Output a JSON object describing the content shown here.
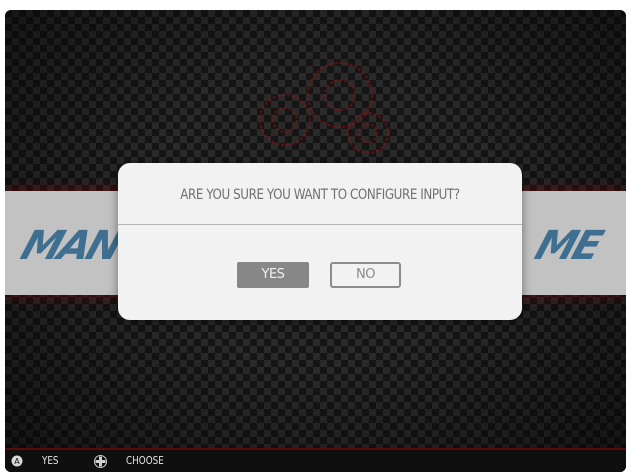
{
  "dialog": {
    "message": "ARE YOU SURE YOU WANT TO CONFIGURE INPUT?",
    "yes_label": "YES",
    "no_label": "NO",
    "selected": "YES"
  },
  "banner": {
    "logo_text": "MAME",
    "logo_left_text": "MAN",
    "logo_right_text": "ME"
  },
  "help": {
    "items": [
      {
        "icon": "a-button-icon",
        "label": "YES"
      },
      {
        "icon": "dpad-icon",
        "label": "CHOOSE"
      }
    ]
  },
  "colors": {
    "background": "#151515",
    "banner": "#c2c2c2",
    "dialog": "#f2f2f2",
    "selected_button": "#878787",
    "logo": "#3f6f90",
    "accent_red": "#8b1a1a"
  }
}
